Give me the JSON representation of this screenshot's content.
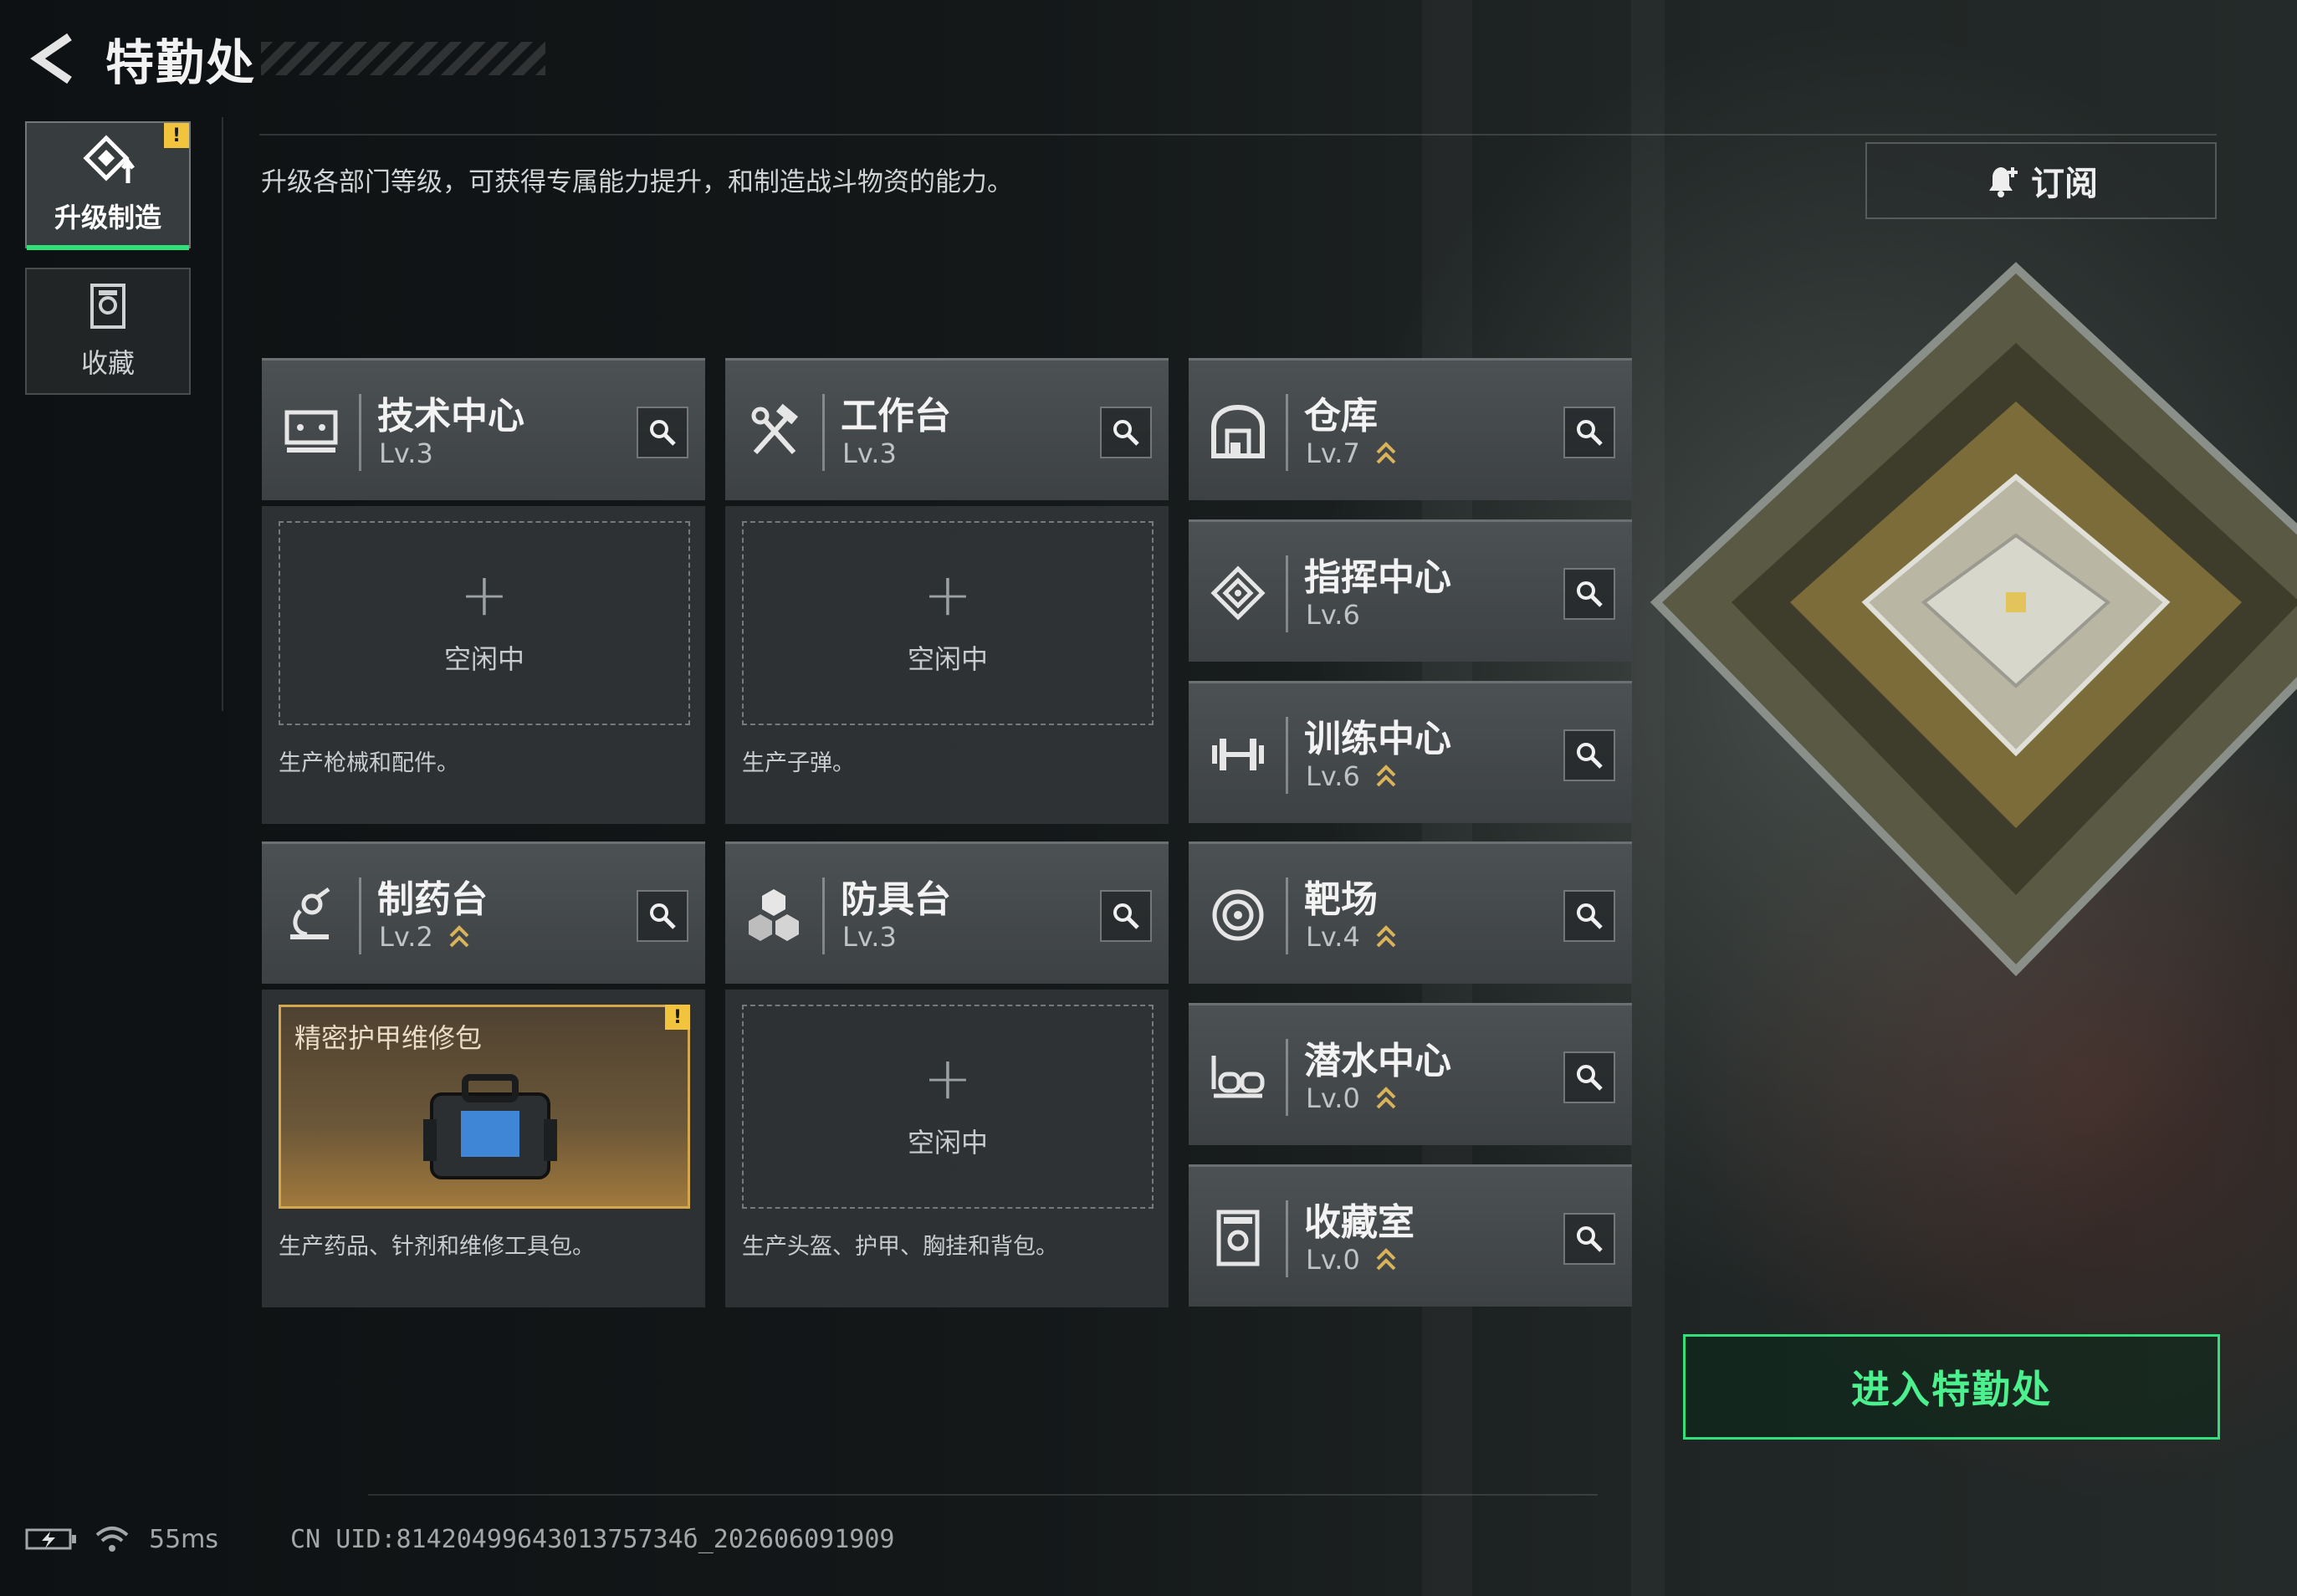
{
  "header": {
    "title": "特勤处"
  },
  "nav": {
    "tabs": [
      {
        "label": "升级制造",
        "active": true,
        "badge": "!"
      },
      {
        "label": "收藏",
        "active": false
      }
    ]
  },
  "description": "升级各部门等级，可获得专属能力提升，和制造战斗物资的能力。",
  "subscribe": {
    "label": "订阅"
  },
  "facilities": {
    "tech_center": {
      "name": "技术中心",
      "level": "Lv.3",
      "slot_state": "空闲中",
      "desc": "生产枪械和配件。"
    },
    "workbench": {
      "name": "工作台",
      "level": "Lv.3",
      "slot_state": "空闲中",
      "desc": "生产子弹。"
    },
    "pharmacy": {
      "name": "制药台",
      "level": "Lv.2",
      "upgradable": true,
      "item_name": "精密护甲维修包",
      "badge": "!",
      "desc": "生产药品、针剂和维修工具包。"
    },
    "armor_bench": {
      "name": "防具台",
      "level": "Lv.3",
      "slot_state": "空闲中",
      "desc": "生产头盔、护甲、胸挂和背包。"
    },
    "warehouse": {
      "name": "仓库",
      "level": "Lv.7",
      "upgradable": true
    },
    "command_center": {
      "name": "指挥中心",
      "level": "Lv.6"
    },
    "training_center": {
      "name": "训练中心",
      "level": "Lv.6",
      "upgradable": true
    },
    "shooting_range": {
      "name": "靶场",
      "level": "Lv.4",
      "upgradable": true
    },
    "diving_center": {
      "name": "潜水中心",
      "level": "Lv.0",
      "upgradable": true
    },
    "collection_room": {
      "name": "收藏室",
      "level": "Lv.0",
      "upgradable": true
    }
  },
  "enter_button": {
    "label": "进入特勤处"
  },
  "status_bar": {
    "ping": "55ms",
    "uid": "CN UID:8142049964301375734б_202606091909"
  },
  "colors": {
    "accent_green": "#2fe07b",
    "badge_yellow": "#f2c33c",
    "upgrade_arrow": "#d9b35a"
  }
}
